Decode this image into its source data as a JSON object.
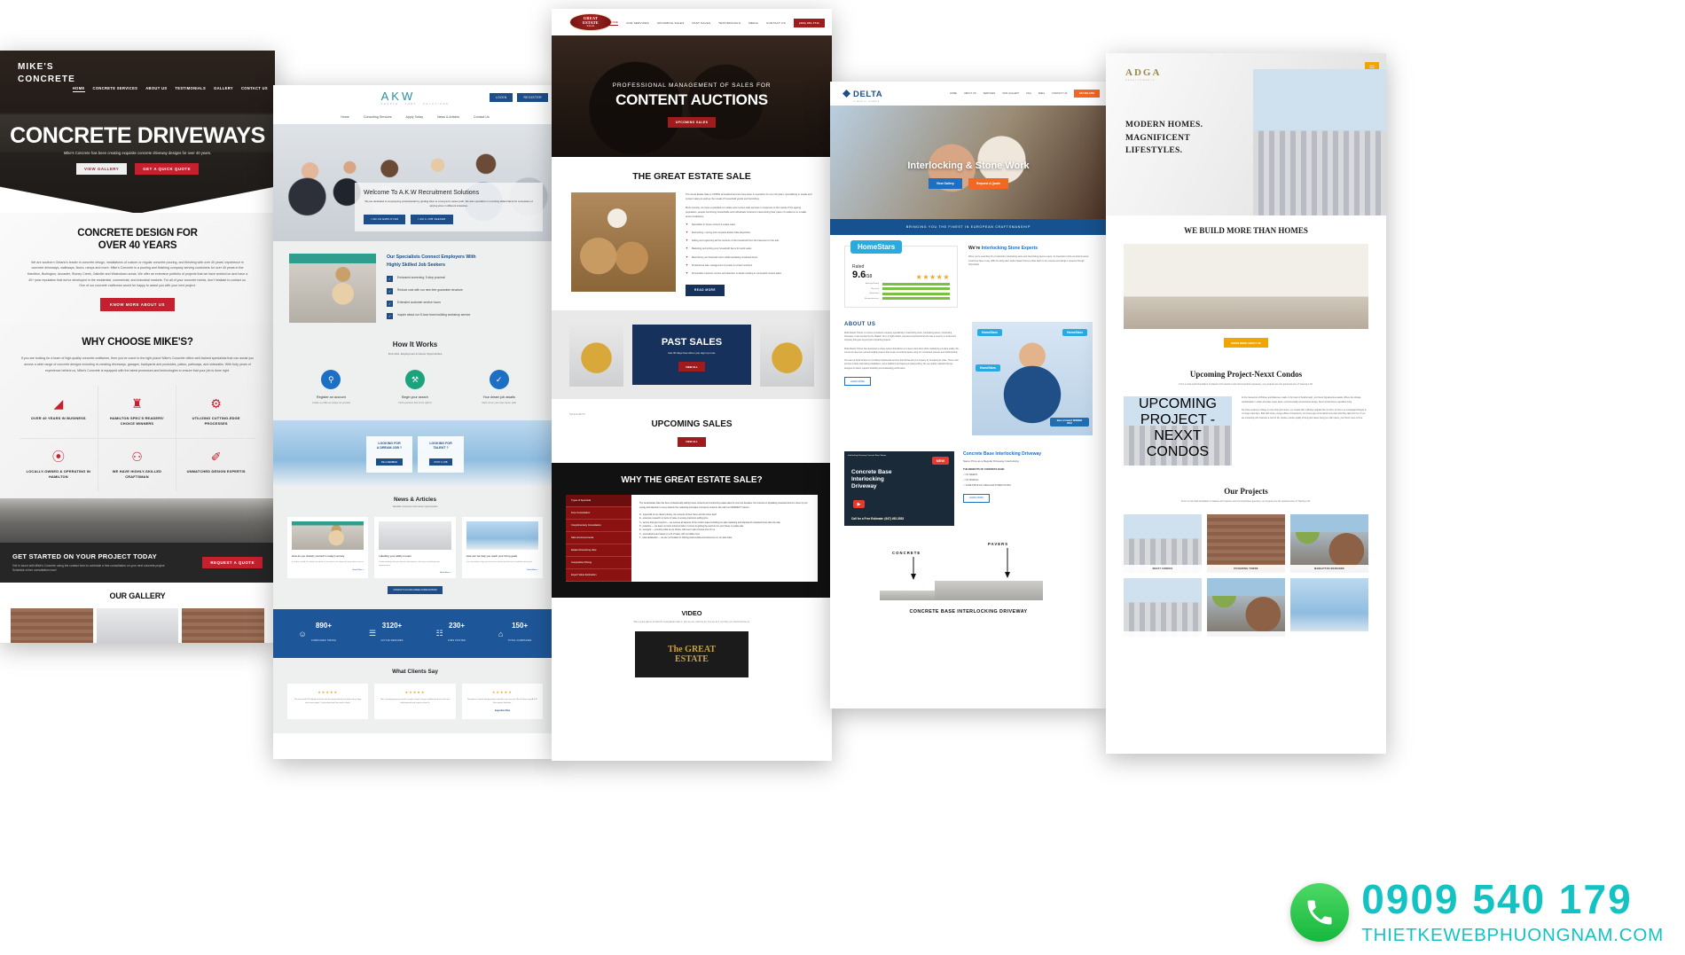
{
  "mock1": {
    "logo": "MIKE'S\nCONCRETE",
    "logo_line1": "MIKE'S",
    "logo_line2": "CONCRETE",
    "nav": [
      "HOME",
      "CONCRETE SERVICES",
      "ABOUT US",
      "TESTIMONIALS",
      "GALLERY",
      "CONTACT US"
    ],
    "hero_title": "CONCRETE DRIVEWAYS",
    "hero_sub": "Mike's Concrete has been creating exquisite concrete driveway designs for over 40 years.",
    "btn_gallery": "VIEW GALLERY",
    "btn_quote": "GET A QUICK QUOTE",
    "sec_title": "CONCRETE DESIGN FOR\nOVER 40 YEARS",
    "sec_title_l1": "CONCRETE DESIGN FOR",
    "sec_title_l2": "OVER 40 YEARS",
    "sec_body": "We are southern Ontario's leader in concrete design, installations of custom or regular concrete pouring, and finishing with over 40 years' experience in concrete driveways, walkways, floors, ramps and more. Mike's Concrete is a pouring and finishing company serving customers for over 40 years in the Hamilton, Burlington, Ancaster, Stoney Creek, Oakville and Waterdown areas. We offer an extensive portfolio of projects that we have worked on and have a 40+ year reputation that we've developed in the residential, commercial, and industrial markets. For all of your concrete needs, don't hesitate to contact us. One of our concrete craftsman would be happy to assist you with your next project.",
    "sec_btn": "KNOW MORE ABOUT US",
    "why_title": "WHY CHOOSE MIKE'S?",
    "why_body": "If you are looking for a team of high-quality concrete craftsmen, then you've come to the right place! Mike's Concrete offers well-trained specialists that can assist you across a wide range of concrete designs including re-creating driveways, garages, backyards and poolsides, patios, pathways, and sidewalks. With forty years of experience behind us, Mike's Concrete is equipped with the latest processes and technologies to ensure that your job is done right.",
    "features": [
      {
        "icon": "chart-growth-icon",
        "glyph": "◢",
        "label": "OVER 40 YEARS IN BUSINESS"
      },
      {
        "icon": "trophy-icon",
        "glyph": "♜",
        "label": "HAMILTON SPEC'S READERS' CHOICE WINNERS"
      },
      {
        "icon": "gear-icon",
        "glyph": "⚙",
        "label": "UTILIZING CUTTING-EDGE PROCESSES"
      },
      {
        "icon": "map-pin-icon",
        "glyph": "⦿",
        "label": "LOCALLY-OWNED & OPERATING IN HAMILTON"
      },
      {
        "icon": "head-idea-icon",
        "glyph": "⚇",
        "label": "WE HAVE HIGHLY-SKILLED CRAFTSMAN"
      },
      {
        "icon": "trowel-icon",
        "glyph": "✐",
        "label": "UNMATCHED DESIGN EXPERTIS"
      }
    ],
    "cta_title": "GET STARTED ON YOUR PROJECT TODAY",
    "cta_body": "Get in touch with Mike's Concrete using the contact form to schedule a free consultation on your next concrete project. Schedule a free consultation now!",
    "cta_btn": "REQUEST A QUOTE",
    "gallery_title": "OUR GALLERY"
  },
  "mock2": {
    "logo": "AKW",
    "logo_sub": "PEOPLE - JOBS - SOLUTIONS",
    "btn_login": "LOGIN",
    "btn_register": "REGISTER",
    "nav": [
      "Home",
      "Consulting Services",
      "Apply Today",
      "News & Articles",
      "Contact Us"
    ],
    "hero_card_title": "Welcome To A.K.W Recruitment Solutions",
    "hero_card_body": "We are dedicated to empowering professionals by guiding them to a long-term career path. We also specialize in recruiting skilled talent for companies of varying sizes in different industries.",
    "hero_btn1": "I AM AN EMPLOYER",
    "hero_btn2": "I AM A JOB SEEKER",
    "spec_title_l1": "Our Specialists Connect Employers With",
    "spec_title_l2": "Highly Skilled Job Seekers",
    "spec_items": [
      "Enhanced screening: 5 step process!",
      "Reduce cost with our new free guarantee structure",
      "Extended customer service hours",
      "Inquire about our 5-hour team building workshop service"
    ],
    "how_title": "How It Works",
    "how_sub": "Find Jobs, Employment & Career Opportunities",
    "steps": [
      {
        "num": "1",
        "icon": "search-icon",
        "glyph": "⚲",
        "title": "Register an account",
        "desc": "Create a profile as unique as yourself",
        "color": "#1d6fc4"
      },
      {
        "num": "2",
        "icon": "briefcase-icon",
        "glyph": "⚒",
        "title": "Begin your search",
        "desc": "Find a position that is the right fit",
        "color": "#1ba37d"
      },
      {
        "num": "3",
        "icon": "checklist-icon",
        "glyph": "✓",
        "title": "Your dream job awaits",
        "desc": "Start out on your new career path",
        "color": "#1d6fc4"
      }
    ],
    "blue_box1_line1": "LOOKING FOR",
    "blue_box1_line2": "A DREAM JOB ?",
    "blue_box1_btn": "BE A MEMBER",
    "blue_box2_line1": "LOOKING FOR",
    "blue_box2_line2": "TALENT ?",
    "blue_box2_btn": "POST A JOB",
    "news_title": "News & Articles",
    "news_sub": "Valuable resources and career opportunities",
    "news_cards": [
      {
        "title": "How do you classify yourself in today's society",
        "body": "In today's world, the labels we attach to ourselves can shape the way others see us.",
        "more": "Read More >"
      },
      {
        "title": "Labelling your ability to learn",
        "body": "Understanding how you absorb information is the key to unlocking new opportunities.",
        "more": "Read More >"
      },
      {
        "title": "How can we help you reach your hiring goals",
        "body": "Our consultants align your business needs with the best available talent pool.",
        "more": "Read More >"
      }
    ],
    "news_btn": "CONTACT US FOR A FREE CONSULTATION",
    "stats": [
      {
        "icon": "users-icon",
        "glyph": "☺",
        "value": "890+",
        "label": "COMPANIES HIRING"
      },
      {
        "icon": "briefcase-icon",
        "glyph": "☰",
        "value": "3120+",
        "label": "ACTIVE RESUMES"
      },
      {
        "icon": "document-icon",
        "glyph": "☷",
        "value": "230+",
        "label": "JOBS POSTED"
      },
      {
        "icon": "building-icon",
        "glyph": "⌂",
        "value": "150+",
        "label": "TOTAL COMPANIES"
      }
    ],
    "test_title": "What Clients Say",
    "testimonials": [
      {
        "stars": "★★★★★",
        "body": "The team at A.K.W helped me find a role that matched both my skills and my long-term career goals. Truly professional from start to finish.",
        "author": ""
      },
      {
        "stars": "★★★★★",
        "body": "Their screening process saved us weeks of work. Every candidate they sent over was well-prepared and a great culture fit.",
        "author": ""
      },
      {
        "stars": "★★★★★",
        "body": "Responsive, honest and genuinely invested in our success. We will keep using A.K.W Recruitment Solutions.",
        "author": "Augustine Silva"
      }
    ]
  },
  "mock3": {
    "logo_top": "The",
    "logo_l1": "GREAT",
    "logo_l2": "ESTATE",
    "logo_l3": "SALE",
    "nav": [
      "HOME",
      "OUR SERVICES",
      "UPCOMING SALES",
      "PAST SALES",
      "TESTIMONIALS",
      "MEDIA",
      "CONTACT US"
    ],
    "phone": "(416) 451-7711",
    "hero_kicker": "PROFESSIONAL MANAGEMENT OF SALES FOR",
    "hero_title": "CONTENT AUCTIONS",
    "hero_btn": "UPCOMING SALES",
    "sale_title": "THE GREAT ESTATE SALE",
    "sale_body_1": "The Great Estate Sale is CPPAG accredited and we have been in operation for over 20 years, specializing in estate and content sales as well as the resale of household goods and furnishing.",
    "sale_body_2": "Most recently, we have expanded our estate and content sale services in response to the needs of the ageing population, people combining households and individuals involved in downsizing their place of residence to smaller accommodations.",
    "sale_bullets": [
      "Specialists in house content & estate sales",
      "Downsizing, moving and complete Estate Sale disposition",
      "Selling and organizing all the contents of the household from the basement to the attic",
      "Marketing and pricing your household items for quick sales",
      "Maximizing your financial return while liquidating unwanted items",
      "Professional sale management of estate & content auctions",
      "Personable customer service and attention to detail resulting in successful content sales"
    ],
    "sale_btn": "READ MORE",
    "past_title": "PAST SALES",
    "past_sub": "Get 30 days free when you sign up now.",
    "past_btn": "VIEW ALL",
    "up_label": "SALE EVENTS",
    "up_title": "UPCOMING SALES",
    "up_btn": "VIEW ALL",
    "why_title": "WHY THE GREAT ESTATE SALE?",
    "why_tabs": [
      "Types of Appraisal",
      "Free Consultation",
      "Complimentary Consultation",
      "Sale Announcements",
      "Estate Downsizing Help",
      "Competitive Pricing",
      "Expert Value Estimation"
    ],
    "why_body_intro": "The Great Estate Sale has been professionally selling house contents and conducting estate sales for over two decades. Our success in liquidating unwanted items is driven by our energy and attention to every detail in the marketing and sales of property contents. We call it our RESPECT mission:",
    "why_body_items": [
      "R - respectful of our clients' privacy, the contents of their home and the home itself",
      "E - extensive research on items of value to ensure maximum selling price",
      "S - service that goes beyond — we oversee all aspects of the content sales including pre-sale marketing and disposal of unwanted items after the sale",
      "P - proactive — we leave no items unturned when it comes to getting the word out on your house or estate sale",
      "E - energetic — ensuring what we do shows, with every sale it shows time for us",
      "C - commissions are based on a % of sales, with no hidden fees",
      "T - total satisfaction — we are not hesitant in offering testimonials and references on our past sales"
    ],
    "video_title": "VIDEO",
    "video_sub": "Take a quick glance at what the Great Estate Sale is, who we are, what we do, how we do it, and why you should choose us.",
    "video_logo_l1": "The GREAT",
    "video_logo_l2": "ESTATE"
  },
  "mock4": {
    "logo": "DELTA",
    "logo_sub": "CLASSIC HOMES",
    "nav": [
      "HOME",
      "ABOUT US",
      "SERVICES",
      "OUR GALLERY",
      "FAQ",
      "AREA",
      "CONTACT US"
    ],
    "phone": "647-984-1650",
    "hero_title": "Interlocking & Stone Work",
    "hero_btn1": "View Gallery",
    "hero_btn2": "Request A Quote",
    "band": "BRINGING YOU THE FINEST IN EUROPEAN CRAFTSMANSHIP",
    "homestars_brand": "HomeStars",
    "rated_label": "Rated",
    "rated_value": "9.6",
    "rated_max": "/10",
    "stars": "★★★★★",
    "bars": [
      {
        "label": "Average Rating",
        "pct": 96
      },
      {
        "label": "Recency",
        "pct": 92
      },
      {
        "label": "Reputation",
        "pct": 94
      },
      {
        "label": "Responsiveness",
        "pct": 90
      }
    ],
    "rate_title_a": "We're ",
    "rate_title_b": "Interlocking Stone Experts",
    "rate_body": "When you're searching for a trustworthy interlocking stone and interlocking pavers expert, it's important to find out what previous customers have to say. With the rating said, Delta Classic Homes prides itself on the reviews and ratings it receives through HomeStars.",
    "about_title": "ABOUT US",
    "about_body_1": "Delta Classic Homes is a home renovations company specializing in interlocking stone, interlocking pavers, interlocking driveways. It was founded by the Hakash. He is a highly skilled, experienced professional who was a need for a construction company that goes beyond just completing projects.",
    "about_body_2": "Delta Classic Homes has developed a unique system that allows us to keep costs down while maintaining excellent quality. We convert an idea into real and tangible projects that create a functional space using our unmatched prowess and craftsmanship.",
    "about_body_3": "Our team at Delta focuses on providing fundamental services that will benefit your property by increasing its value. These main services include interlocking installations, stone additions and basement waterproofing. We use quality materials that are designed to deliver superior durability and outstanding performance.",
    "about_btn": "LEARN MORE",
    "hs_badges": [
      "HomeStars",
      "HomeStars",
      "HomeStars",
      "Best of Award WINNER 2019"
    ],
    "promo_tag": "Interlocking Driveway Concrete Base Shown",
    "promo_new": "NEW",
    "promo_title_l1": "Concrete Base",
    "promo_title_l2": "Interlocking",
    "promo_title_l3": "Driveway",
    "promo_cta_l1": "Call for a Free Estimate:",
    "promo_cta_l2": "(647) 492-3533",
    "promo_side_title": "Concrete Base Interlocking Driveway",
    "promo_side_sub": "Same Price as a Regular Driveway Interlocking",
    "promo_side_head": "THE BENEFITS OF CONCRETE BASE:",
    "promo_side_checks": [
      "✓ NO WEEDS!",
      "✓ NO SINKING!",
      "✓ SAME PRICE AS A REGULAR INTERLOCKING"
    ],
    "promo_side_btn": "LEARN MORE",
    "diag_label_left": "CONCRETE",
    "diag_label_right": "PAVERS",
    "diag_caption": "CONCRETE BASE INTERLOCKING DRIVEWAY"
  },
  "mock5": {
    "logo": "ADGA",
    "logo_sub": "DEVELOPMENTS",
    "menu_icon": "hamburger-menu-icon",
    "hero_l1": "MODERN HOMES.",
    "hero_l2": "MAGNIFICENT",
    "hero_l3": "LIFESTYLES.",
    "sec_title": "WE BUILD MORE THAN HOMES",
    "sec_btn": "KNOW MORE ABOUT US",
    "up_title": "Upcoming Project-Nexxt Condos",
    "up_sub": "From a rock-solid foundation to feature-rich interiors and circumambient greenery, our projects are the quintessence of 'Having it all'.",
    "up_caption": "UPCOMING PROJECT - NEXXT CONDOS",
    "up_body_1": "At the intersection of Brimley and Ellesmere roads, in the heart of Scarborough, your Nexxt big adventure awaits. Where the ultimate sophistication in urban amenities meets sleek, environmentally conscientious design, Nexxt condominium expedition living.",
    "up_body_2": "For those seeking a change in more than just homes, our condos offer a lifestyle upgrade like no other. At Nexxt, an extravagant lifestyle is no longer expensive. Built with smart, energy-efficient components, our homes give to the Earth more than what they take from her. If you are somebody who channels a zest for life, desires a better quality of living and values being one with nature, your Nexxt move is here.",
    "proj_title": "Our Projects",
    "proj_sub": "From a rock-solid foundation to feature-rich interiors and circumambient greenery, our projects are the quintessence of 'Having it all'.",
    "projects": [
      {
        "caption": "NEXXT CONDOS"
      },
      {
        "caption": "PICKERING TOWNS"
      },
      {
        "caption": "MANHATTAN MANSIONS"
      },
      {
        "caption": ""
      },
      {
        "caption": ""
      },
      {
        "caption": ""
      }
    ]
  },
  "watermark": {
    "icon": "phone-circle-icon",
    "phone": "0909 540 179",
    "site": "THIETKEWEBPHUONGNAM.COM",
    "color": "#13c3c3",
    "circle_color": "#16b83e"
  }
}
